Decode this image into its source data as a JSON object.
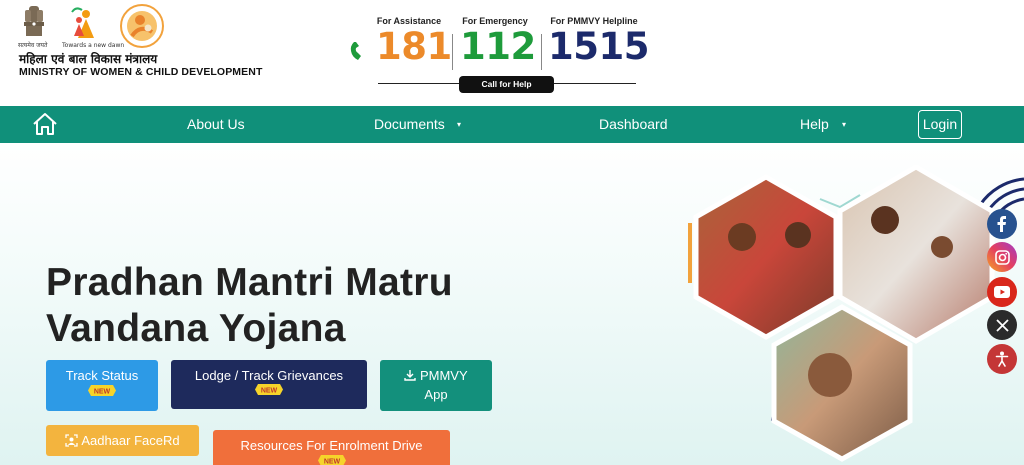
{
  "header": {
    "emblem_caption": "सत्यमेव जयते",
    "wcd_caption": "Towards a new dawn",
    "ministry_hindi": "महिला एवं बाल विकास मंत्रालय",
    "ministry_english": "MINISTRY OF WOMEN & CHILD DEVELOPMENT",
    "helplines": [
      {
        "caption": "For Assistance",
        "number": "181",
        "color": "#ec8a2a"
      },
      {
        "caption": "For Emergency",
        "number": "112",
        "color": "#1e9b3b"
      },
      {
        "caption": "For PMMVY Helpline",
        "number": "1515",
        "color": "#1c2a6b"
      }
    ],
    "call_for_help": "Call for Help"
  },
  "nav": {
    "items": [
      {
        "label": "About Us",
        "has_dropdown": false
      },
      {
        "label": "Documents",
        "has_dropdown": true
      },
      {
        "label": "Dashboard",
        "has_dropdown": false
      },
      {
        "label": "Help",
        "has_dropdown": true
      }
    ],
    "caret": "▾",
    "login": "Login",
    "background": "#10907a"
  },
  "hero": {
    "title_line1": "Pradhan Mantri Matru",
    "title_line2": "Vandana Yojana",
    "buttons": {
      "track_status": "Track Status",
      "lodge_grievances": "Lodge / Track Grievances",
      "pmmvy_app_line1": "PMMVY",
      "pmmvy_app_line2": "App",
      "aadhaar_facerd": "Aadhaar FaceRd",
      "resources": "Resources For Enrolment Drive"
    },
    "new_badge": "NEW"
  },
  "social": [
    "facebook-icon",
    "instagram-icon",
    "youtube-icon",
    "x-icon",
    "accessibility-icon"
  ],
  "colors": {
    "teal": "#10907a",
    "navy": "#1e2a5c",
    "blue": "#2d9ae6",
    "orange": "#f06f3b",
    "yellow": "#f3b43e"
  }
}
